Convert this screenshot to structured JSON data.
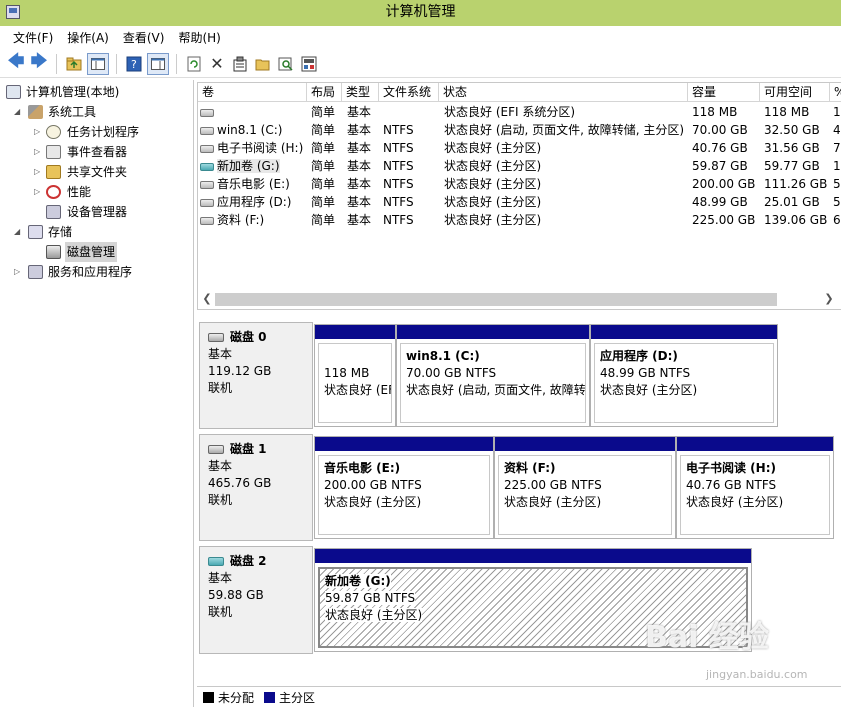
{
  "window": {
    "title": "计算机管理"
  },
  "menu": [
    "文件(F)",
    "操作(A)",
    "查看(V)",
    "帮助(H)"
  ],
  "toolbar_icons": [
    "back-arrow-icon",
    "forward-arrow-icon",
    "up-folder-icon",
    "show-hide-tree-icon",
    "help-icon",
    "properties-pane-icon",
    "refresh-icon",
    "delete-icon",
    "properties-icon",
    "open-icon",
    "search-icon",
    "export-icon"
  ],
  "tree": {
    "root": "计算机管理(本地)",
    "system_tools": "系统工具",
    "task_scheduler": "任务计划程序",
    "event_viewer": "事件查看器",
    "shared_folders": "共享文件夹",
    "performance": "性能",
    "device_manager": "设备管理器",
    "storage": "存储",
    "disk_management": "磁盘管理",
    "services": "服务和应用程序"
  },
  "volumes": {
    "headers": [
      "卷",
      "布局",
      "类型",
      "文件系统",
      "状态",
      "容量",
      "可用空间",
      "%"
    ],
    "rows": [
      {
        "vol": "",
        "layout": "简单",
        "type": "基本",
        "fs": "",
        "status": "状态良好 (EFI 系统分区)",
        "cap": "118 MB",
        "free": "118 MB",
        "pct": "1",
        "icon": "gray"
      },
      {
        "vol": "win8.1 (C:)",
        "layout": "简单",
        "type": "基本",
        "fs": "NTFS",
        "status": "状态良好 (启动, 页面文件, 故障转储, 主分区)",
        "cap": "70.00 GB",
        "free": "32.50 GB",
        "pct": "4",
        "icon": "gray"
      },
      {
        "vol": "电子书阅读 (H:)",
        "layout": "简单",
        "type": "基本",
        "fs": "NTFS",
        "status": "状态良好 (主分区)",
        "cap": "40.76 GB",
        "free": "31.56 GB",
        "pct": "7",
        "icon": "gray"
      },
      {
        "vol": "新加卷 (G:)",
        "layout": "简单",
        "type": "基本",
        "fs": "NTFS",
        "status": "状态良好 (主分区)",
        "cap": "59.87 GB",
        "free": "59.77 GB",
        "pct": "1",
        "icon": "teal"
      },
      {
        "vol": "音乐电影 (E:)",
        "layout": "简单",
        "type": "基本",
        "fs": "NTFS",
        "status": "状态良好 (主分区)",
        "cap": "200.00 GB",
        "free": "111.26 GB",
        "pct": "5",
        "icon": "gray"
      },
      {
        "vol": "应用程序 (D:)",
        "layout": "简单",
        "type": "基本",
        "fs": "NTFS",
        "status": "状态良好 (主分区)",
        "cap": "48.99 GB",
        "free": "25.01 GB",
        "pct": "5",
        "icon": "gray"
      },
      {
        "vol": "资料 (F:)",
        "layout": "简单",
        "type": "基本",
        "fs": "NTFS",
        "status": "状态良好 (主分区)",
        "cap": "225.00 GB",
        "free": "139.06 GB",
        "pct": "6",
        "icon": "gray"
      }
    ]
  },
  "disks": [
    {
      "name": "磁盘 0",
      "kind": "基本",
      "size": "119.12 GB",
      "state": "联机",
      "partitions": [
        {
          "name": "",
          "size": "118 MB",
          "status": "状态良好 (EFI"
        },
        {
          "name": "win8.1  (C:)",
          "size": "70.00 GB NTFS",
          "status": "状态良好 (启动, 页面文件, 故障转"
        },
        {
          "name": "应用程序  (D:)",
          "size": "48.99 GB NTFS",
          "status": "状态良好 (主分区)"
        }
      ]
    },
    {
      "name": "磁盘 1",
      "kind": "基本",
      "size": "465.76 GB",
      "state": "联机",
      "partitions": [
        {
          "name": "音乐电影  (E:)",
          "size": "200.00 GB NTFS",
          "status": "状态良好 (主分区)"
        },
        {
          "name": "资料  (F:)",
          "size": "225.00 GB NTFS",
          "status": "状态良好 (主分区)"
        },
        {
          "name": "电子书阅读  (H:)",
          "size": "40.76 GB NTFS",
          "status": "状态良好 (主分区)"
        }
      ]
    },
    {
      "name": "磁盘 2",
      "kind": "基本",
      "size": "59.88 GB",
      "state": "联机",
      "partitions": [
        {
          "name": "新加卷  (G:)",
          "size": "59.87 GB NTFS",
          "status": "状态良好 (主分区)"
        }
      ]
    }
  ],
  "legend": {
    "unallocated": "未分配",
    "primary": "主分区",
    "unallocated_color": "#000000",
    "primary_color": "#0a0a8c"
  },
  "watermark": {
    "main": "Bai 经验",
    "sub": "jingyan.baidu.com"
  },
  "colors": {
    "titlebar": "#b9d26e",
    "partition_bar": "#0a0a8c"
  }
}
